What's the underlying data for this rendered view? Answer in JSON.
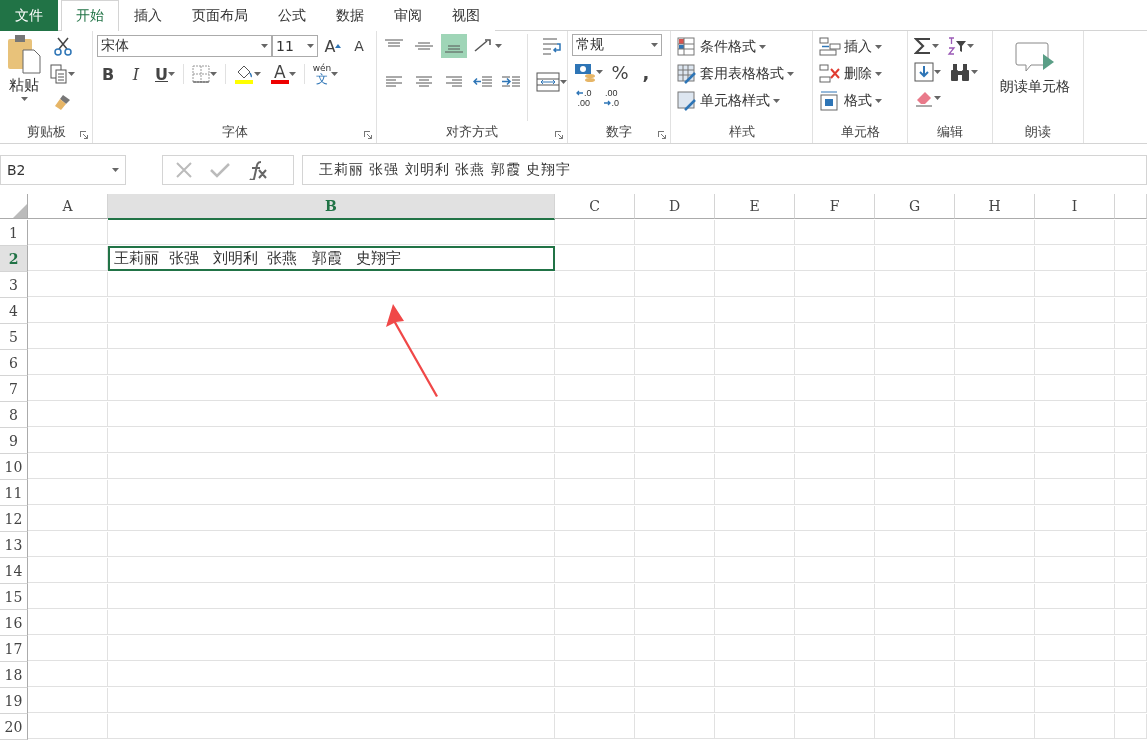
{
  "tabs": [
    {
      "label": "文件",
      "kind": "file",
      "selected": false
    },
    {
      "label": "开始",
      "kind": "tab",
      "selected": true
    },
    {
      "label": "插入",
      "kind": "tab",
      "selected": false
    },
    {
      "label": "页面布局",
      "kind": "tab",
      "selected": false
    },
    {
      "label": "公式",
      "kind": "tab",
      "selected": false
    },
    {
      "label": "数据",
      "kind": "tab",
      "selected": false
    },
    {
      "label": "审阅",
      "kind": "tab",
      "selected": false
    },
    {
      "label": "视图",
      "kind": "tab",
      "selected": false
    }
  ],
  "ribbon": {
    "groups": [
      {
        "kind": "clipboard",
        "label": "剪贴板",
        "launcher": true,
        "paste_label": "粘贴"
      },
      {
        "kind": "font",
        "label": "字体",
        "launcher": true,
        "font_name": "宋体",
        "font_size": "11",
        "grow": "A",
        "shrink": "A",
        "styles": [
          "B",
          "I",
          "U"
        ],
        "font_color": "A",
        "phonetic_top": "wén",
        "phonetic_bottom": "文"
      },
      {
        "kind": "alignment",
        "label": "对齐方式",
        "launcher": true,
        "align_buttons": [
          {
            "kind": "top",
            "selected": false
          },
          {
            "kind": "middle",
            "selected": false
          },
          {
            "kind": "bottom",
            "selected": true
          },
          {
            "kind": "left",
            "selected": false
          },
          {
            "kind": "center",
            "selected": false
          },
          {
            "kind": "right",
            "selected": false
          }
        ]
      },
      {
        "kind": "number",
        "label": "数字",
        "launcher": true,
        "format": "常规",
        "percent": "%",
        "comma": ",",
        "decimals": [
          {
            "kind": "increase",
            "upper": ".0",
            "lower": ".00"
          },
          {
            "kind": "decrease",
            "upper": ".00",
            "lower": ".0"
          }
        ]
      },
      {
        "kind": "styles",
        "label": "样式",
        "launcher": false,
        "items": [
          {
            "kind": "conditional",
            "label": "条件格式"
          },
          {
            "kind": "table",
            "label": "套用表格格式"
          },
          {
            "kind": "cellstyle",
            "label": "单元格样式"
          }
        ]
      },
      {
        "kind": "cells",
        "label": "单元格",
        "launcher": false,
        "items": [
          {
            "kind": "insert",
            "label": "插入"
          },
          {
            "kind": "delete",
            "label": "删除"
          },
          {
            "kind": "format",
            "label": "格式"
          }
        ]
      },
      {
        "kind": "editing",
        "label": "编辑",
        "launcher": false
      },
      {
        "kind": "read",
        "label": "朗读",
        "launcher": false,
        "button": "朗读单元格"
      }
    ]
  },
  "formula_bar": {
    "name_box": "B2",
    "formula": "王莉丽 张强 刘明利 张燕 郭霞 史翔宇"
  },
  "sheet": {
    "columns": [
      {
        "label": "A",
        "selected": false
      },
      {
        "label": "B",
        "selected": true
      },
      {
        "label": "C",
        "selected": false
      },
      {
        "label": "D",
        "selected": false
      },
      {
        "label": "E",
        "selected": false
      },
      {
        "label": "F",
        "selected": false
      },
      {
        "label": "G",
        "selected": false
      },
      {
        "label": "H",
        "selected": false
      },
      {
        "label": "I",
        "selected": false
      }
    ],
    "rows": [
      {
        "label": "1",
        "selected": false
      },
      {
        "label": "2",
        "selected": true,
        "values": {
          "B": "王莉丽  张强   刘明利  张燕   郭霞   史翔宇"
        }
      },
      {
        "label": "3",
        "selected": false
      },
      {
        "label": "4",
        "selected": false
      },
      {
        "label": "5",
        "selected": false
      },
      {
        "label": "6",
        "selected": false
      },
      {
        "label": "7",
        "selected": false
      },
      {
        "label": "8",
        "selected": false
      },
      {
        "label": "9",
        "selected": false
      },
      {
        "label": "10",
        "selected": false
      },
      {
        "label": "11",
        "selected": false
      },
      {
        "label": "12",
        "selected": false
      },
      {
        "label": "13",
        "selected": false
      },
      {
        "label": "14",
        "selected": false
      },
      {
        "label": "15",
        "selected": false
      },
      {
        "label": "16",
        "selected": false
      },
      {
        "label": "17",
        "selected": false
      },
      {
        "label": "18",
        "selected": false
      },
      {
        "label": "19",
        "selected": false
      },
      {
        "label": "20",
        "selected": false
      }
    ]
  }
}
